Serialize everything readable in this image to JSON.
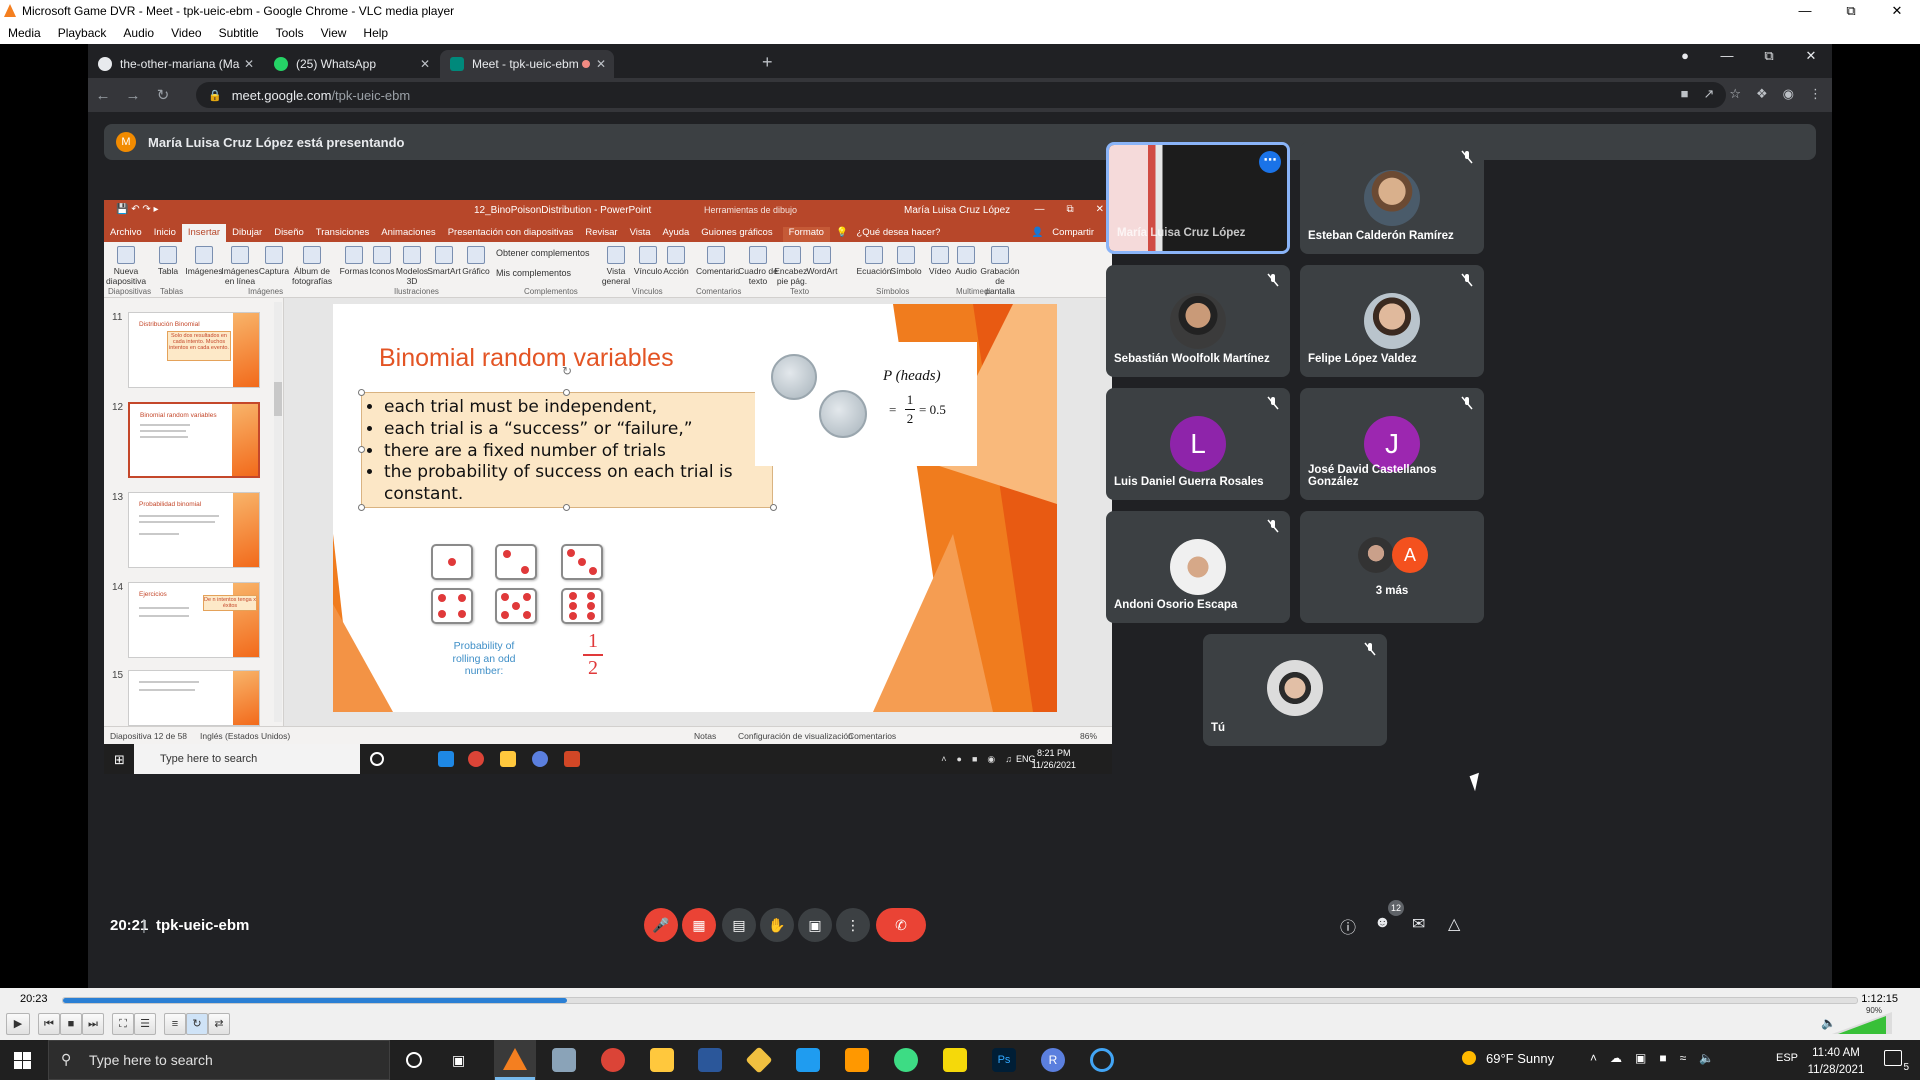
{
  "vlc": {
    "window_title": "Microsoft Game DVR - Meet - tpk-ueic-ebm - Google Chrome - VLC media player",
    "menu": [
      "Media",
      "Playback",
      "Audio",
      "Video",
      "Subtitle",
      "Tools",
      "View",
      "Help"
    ],
    "time_elapsed": "20:23",
    "time_total": "1:12:15",
    "progress": 0.281,
    "volume_label": "90%",
    "volume": 0.9,
    "accent": "#f47f20"
  },
  "chrome": {
    "tabs": [
      {
        "title": "the-other-mariana (Mariana Ával",
        "icon": "github-icon"
      },
      {
        "title": "(25) WhatsApp",
        "icon": "whatsapp-icon"
      },
      {
        "title": "Meet - tpk-ueic-ebm",
        "icon": "meet-icon",
        "active": true
      }
    ],
    "url_host": "meet.google.com",
    "url_path": "/tpk-ueic-ebm"
  },
  "meet": {
    "presenting_initial": "M",
    "presenting_text": "María Luisa Cruz López está presentando",
    "time": "20:21",
    "separator": "|",
    "meeting_code": "tpk-ueic-ebm",
    "participant_count": "12",
    "participants": [
      {
        "name": "María Luisa Cruz López",
        "speaking": true
      },
      {
        "name": "Esteban Calderón Ramírez",
        "muted": true
      },
      {
        "name": "Sebastián Woolfolk Martínez",
        "muted": true
      },
      {
        "name": "Felipe López Valdez",
        "muted": true
      },
      {
        "name": "Luis Daniel Guerra Rosales",
        "initial": "L",
        "color": "#8e24aa",
        "muted": true
      },
      {
        "name": "José David Castellanos González",
        "initial": "J",
        "color": "#9c27b0",
        "muted": true
      },
      {
        "name": "Andoni Osorio Escapa",
        "muted": true
      },
      {
        "name": "3 más",
        "initial": "A",
        "color": "#f4511e"
      },
      {
        "name": "Tú",
        "muted": true
      }
    ]
  },
  "powerpoint": {
    "file_title": "12_BinoPoisonDistribution - PowerPoint",
    "tools_label": "Herramientas de dibujo",
    "user": "María Luisa Cruz López",
    "tabs": [
      "Archivo",
      "Inicio",
      "Insertar",
      "Dibujar",
      "Diseño",
      "Transiciones",
      "Animaciones",
      "Presentación con diapositivas",
      "Revisar",
      "Vista",
      "Ayuda",
      "Guiones gráficos"
    ],
    "format_tab": "Formato",
    "tell_me": "¿Qué desea hacer?",
    "share": "Compartir",
    "ribbon_items": [
      "Nueva diapositiva",
      "Tabla",
      "Imágenes",
      "Imágenes en línea",
      "Captura",
      "Álbum de fotografías",
      "Formas",
      "Iconos",
      "Modelos 3D",
      "SmartArt",
      "Gráfico",
      "Obtener complementos",
      "Mis complementos",
      "Vista general",
      "Vínculo",
      "Acción",
      "Comentario",
      "Cuadro de texto",
      "Encabez. pie pág.",
      "WordArt",
      "Ecuación",
      "Símbolo",
      "Vídeo",
      "Audio",
      "Grabación de pantalla"
    ],
    "ribbon_groups": [
      "Diapositivas",
      "Tablas",
      "Imágenes",
      "Ilustraciones",
      "Complementos",
      "Vínculos",
      "Comentarios",
      "Texto",
      "Símbolos",
      "Multimedia"
    ],
    "thumbs": [
      {
        "num": "11",
        "title": "Distribución Binomial",
        "box": "Solo dos resultados en cada intento. Muchos intentos en cada evento."
      },
      {
        "num": "12",
        "title": "Binomial random variables",
        "selected": true
      },
      {
        "num": "13",
        "title": "Probabilidad binomial"
      },
      {
        "num": "14",
        "title": "Ejercicios",
        "box": "De n intentos tenga x éxitos"
      },
      {
        "num": "15",
        "title": ""
      }
    ],
    "slide": {
      "title": "Binomial random variables",
      "bullets": [
        "each trial must be independent,",
        "each trial is a “success” or “failure,”",
        "there are a fixed number of trials",
        "the probability of success on each trial is constant."
      ],
      "heads_label": "P (heads)",
      "heads_eq": "= 0.5",
      "frac_num": "1",
      "frac_den": "2",
      "dice_caption": "Probability of rolling an odd number:",
      "dice_frac_num": "1",
      "dice_frac_den": "2"
    },
    "status_slide": "Diapositiva 12 de 58",
    "status_lang": "Inglés (Estados Unidos)",
    "status_notes": "Notas",
    "status_display": "Configuración de visualización",
    "status_comments": "Comentarios",
    "zoom": "86%",
    "inner_search": "Type here to search",
    "inner_lang": "ENG",
    "inner_time": "8:21 PM",
    "inner_date": "11/26/2021"
  },
  "taskbar": {
    "search_placeholder": "Type here to search",
    "weather": "69°F  Sunny",
    "lang": "ESP",
    "time": "11:40 AM",
    "date": "11/28/2021",
    "notif_count": "5"
  }
}
